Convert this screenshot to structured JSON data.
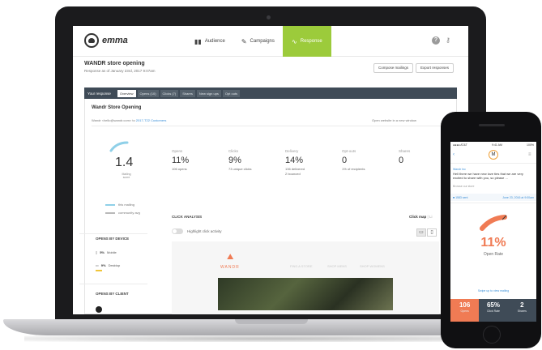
{
  "app": {
    "logo_text": "emma",
    "nav": [
      {
        "label": "Audience",
        "icon": "bar-chart-icon"
      },
      {
        "label": "Campaigns",
        "icon": "edit-icon"
      },
      {
        "label": "Response",
        "icon": "trend-line-icon"
      }
    ],
    "help_glyph": "?",
    "key_glyph": "⚷"
  },
  "page": {
    "title": "WANDR store opening",
    "subtitle": "Response as of January 23rd, 2017 9:07am",
    "compose_label": "Compose mailings",
    "export_label": "Export responses"
  },
  "tabs": {
    "label": "Your response",
    "items": [
      "Overview",
      "Opens (10)",
      "Clicks (7)",
      "Shares",
      "New sign ups",
      "Opt outs"
    ],
    "active_index": 0
  },
  "mailing": {
    "title": "Wandr Store Opening",
    "from_prefix": "Wandr <hello@wandr.com> to",
    "from_link": "2017-T22 Customers",
    "open_link": "Open website in a new window"
  },
  "score": {
    "value": "1.4",
    "label": "Mailing score"
  },
  "metrics": [
    {
      "label": "Opens",
      "value": "11%",
      "sub": "106 opens"
    },
    {
      "label": "Clicks",
      "value": "9%",
      "sub": "73 unique clicks"
    },
    {
      "label": "Delivery",
      "value": "14%",
      "sub": "136 delivered\n2 bounced"
    },
    {
      "label": "Opt-outs",
      "value": "0",
      "sub": "1% of recipients"
    },
    {
      "label": "Shares",
      "value": "0",
      "sub": ""
    }
  ],
  "legend": [
    {
      "label": "this mailing",
      "color": "#8fd0e8"
    },
    {
      "label": "community avg",
      "color": "#b9b9b9"
    }
  ],
  "click_analysis": {
    "heading": "CLICK ANALYSIS",
    "tool_active": "Click map",
    "tool_other": "Li",
    "toggle_label": "Highlight click activity"
  },
  "devices": {
    "heading": "OPENS BY DEVICE",
    "items": [
      {
        "icon": "mobile-icon",
        "value": "5%",
        "label": "Mobile"
      },
      {
        "icon": "desktop-icon",
        "value": "9%",
        "label": "Desktop"
      }
    ],
    "client_heading": "OPENS BY CLIENT"
  },
  "preview": {
    "brand": "WANDR",
    "links": [
      "FIND A STORE",
      "SHOP MENS",
      "SHOP WOMENS"
    ]
  },
  "phone": {
    "status_left": "●●●● AT&T",
    "status_time": "9:41 AM",
    "status_right": "100%",
    "avatar_letter": "M",
    "sender": "Wandr Inc",
    "message": "Hell there we have new love ties that we are very excited to share with you, so please ...",
    "message_sub": "Browse our store",
    "meta_left": "■ 1583 sent",
    "meta_right": "June 23, 2016 at 9:00am",
    "open_rate_value": "11%",
    "open_rate_label": "Open Rate",
    "tip": "Swipe up to view mailing",
    "stats": [
      {
        "value": "106",
        "label": "Opens"
      },
      {
        "value": "65%",
        "label": "Click Rate"
      },
      {
        "value": "2",
        "label": "Shares"
      }
    ]
  },
  "colors": {
    "accent_green": "#9ccb3b",
    "gauge_orange": "#f07b54",
    "nav_dark": "#3f4b57",
    "link_blue": "#3a8fd8"
  }
}
